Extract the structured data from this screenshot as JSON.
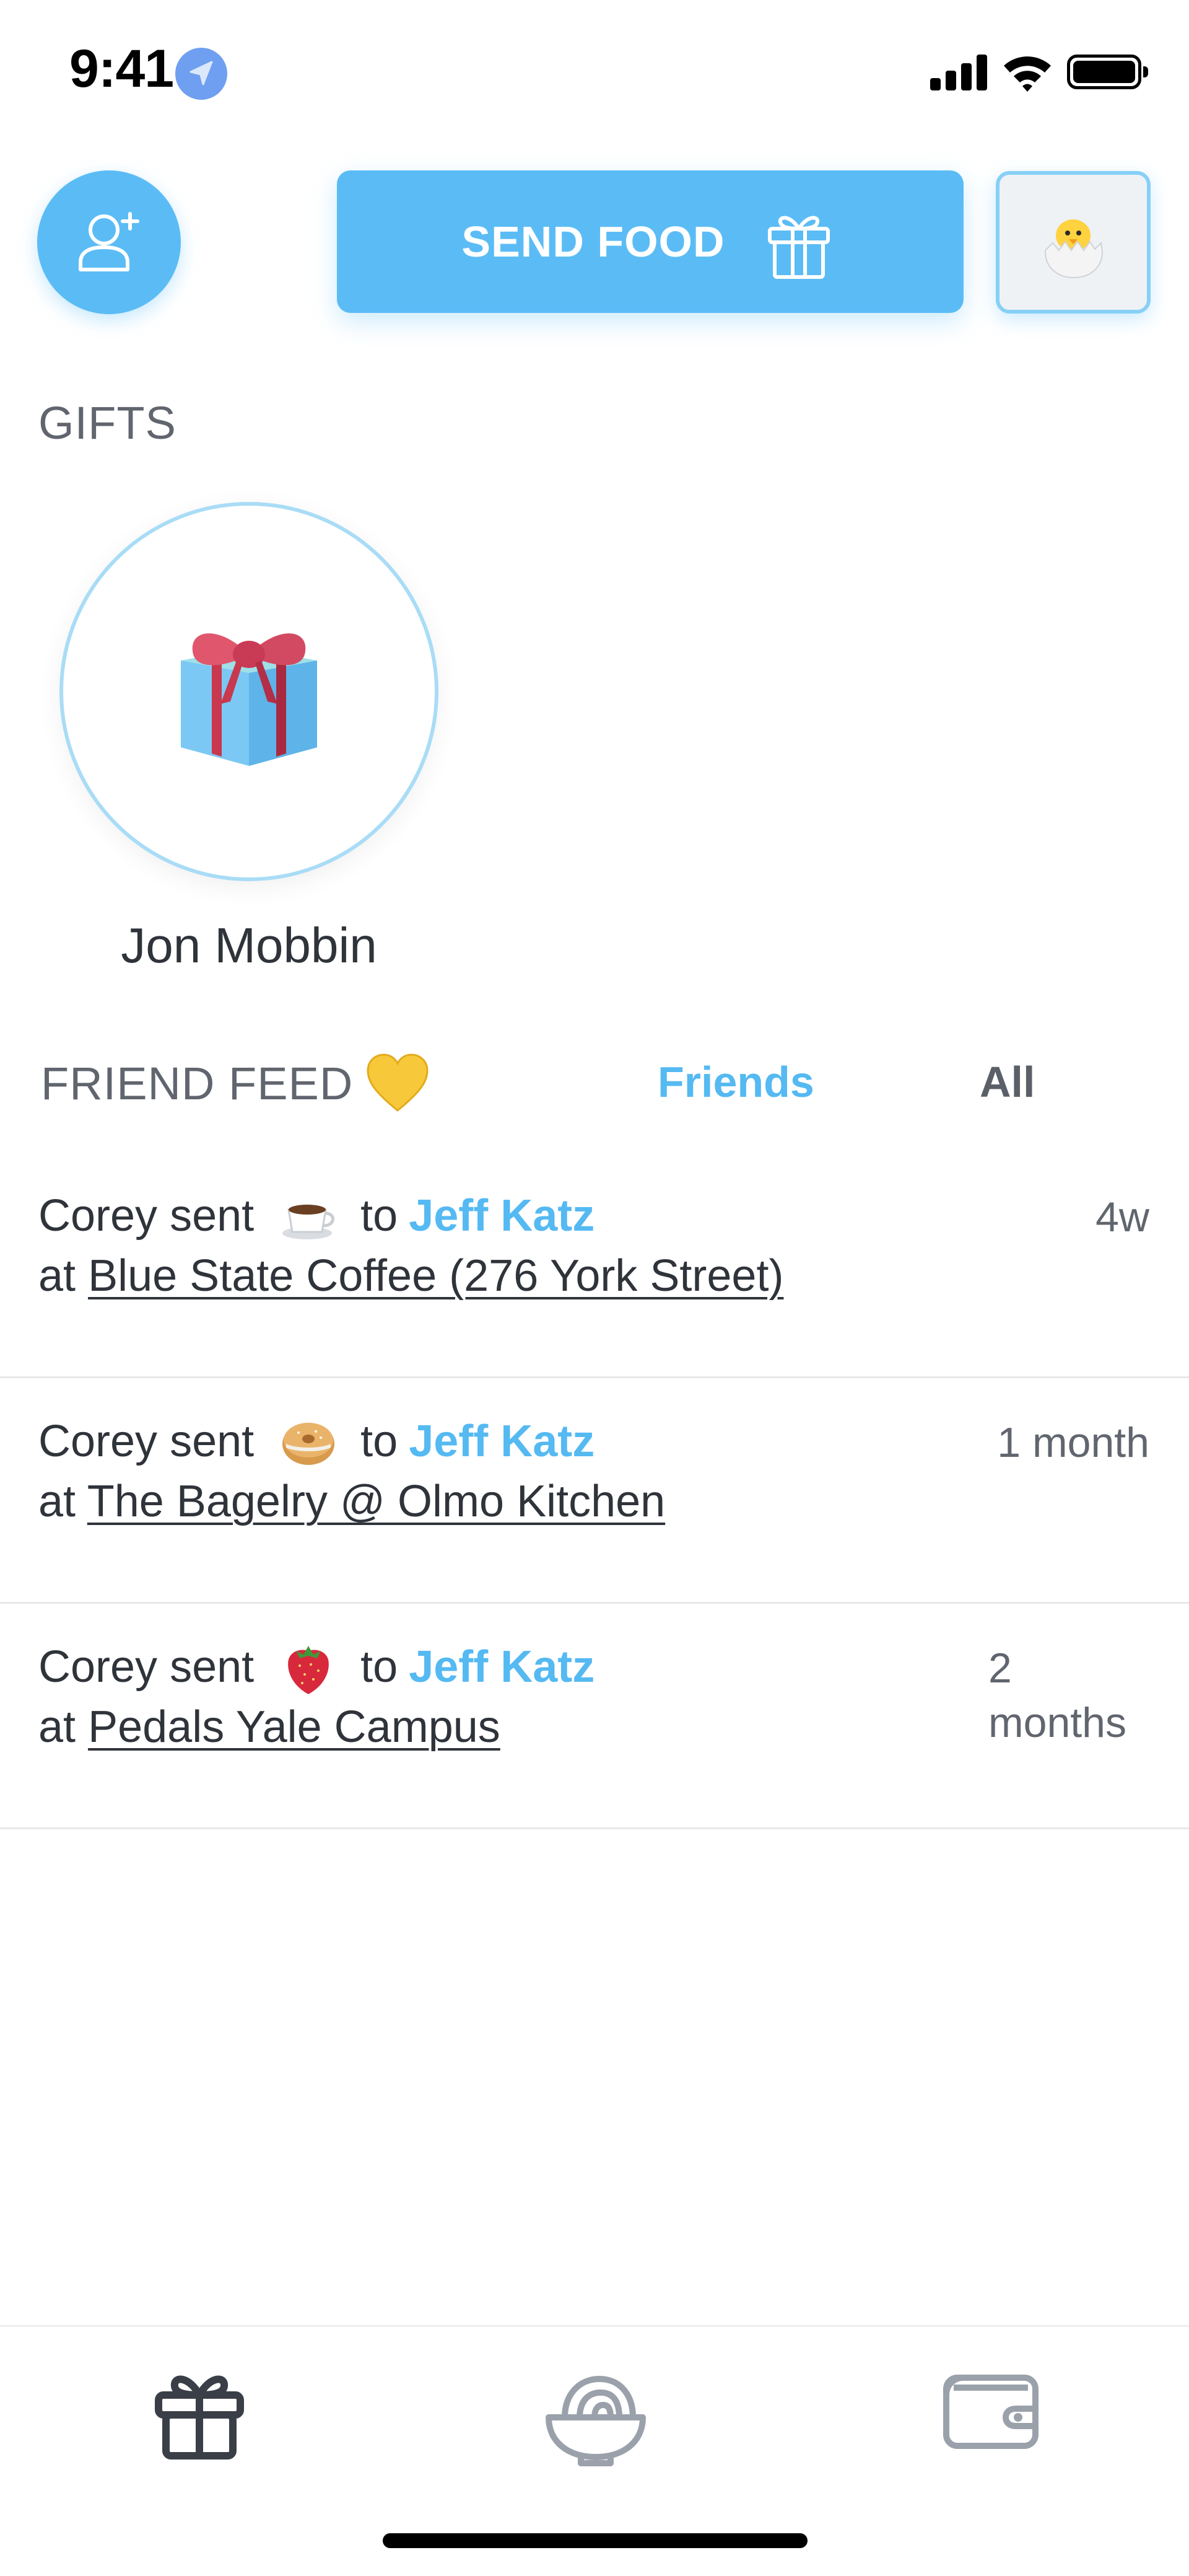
{
  "status_bar": {
    "time": "9:41"
  },
  "header": {
    "send_food_label": "SEND FOOD",
    "icons": [
      "add-friend-icon",
      "gift-icon",
      "hatching-chick-icon"
    ]
  },
  "gifts": {
    "heading": "GIFTS",
    "items": [
      {
        "name": "Jon Mobbin",
        "icon": "wrapped-gift-icon"
      }
    ]
  },
  "friend_feed": {
    "heading": "FRIEND FEED",
    "heart_icon": "yellow-heart-icon",
    "tabs": [
      {
        "label": "Friends",
        "active": true
      },
      {
        "label": "All",
        "active": false
      }
    ],
    "items": [
      {
        "sender_text": "Corey sent",
        "item_icon": "coffee-icon",
        "to_text": "to",
        "recipient": "Jeff Katz",
        "at_text": "at",
        "place": "Blue State Coffee (276 York Street)",
        "time": "4w"
      },
      {
        "sender_text": "Corey sent",
        "item_icon": "bagel-icon",
        "to_text": "to",
        "recipient": "Jeff Katz",
        "at_text": "at",
        "place": "The Bagelry @ Olmo Kitchen",
        "time": "1 month"
      },
      {
        "sender_text": "Corey sent",
        "item_icon": "strawberry-icon",
        "to_text": "to",
        "recipient": "Jeff Katz",
        "at_text": "at",
        "place": "Pedals Yale Campus",
        "time": "2 months"
      }
    ]
  },
  "tab_bar": {
    "icons": [
      "gift-tab-icon",
      "food-bowl-tab-icon",
      "wallet-tab-icon"
    ]
  },
  "colors": {
    "accent": "#5bbcf5",
    "text": "#2f333a",
    "muted": "#60656e"
  }
}
